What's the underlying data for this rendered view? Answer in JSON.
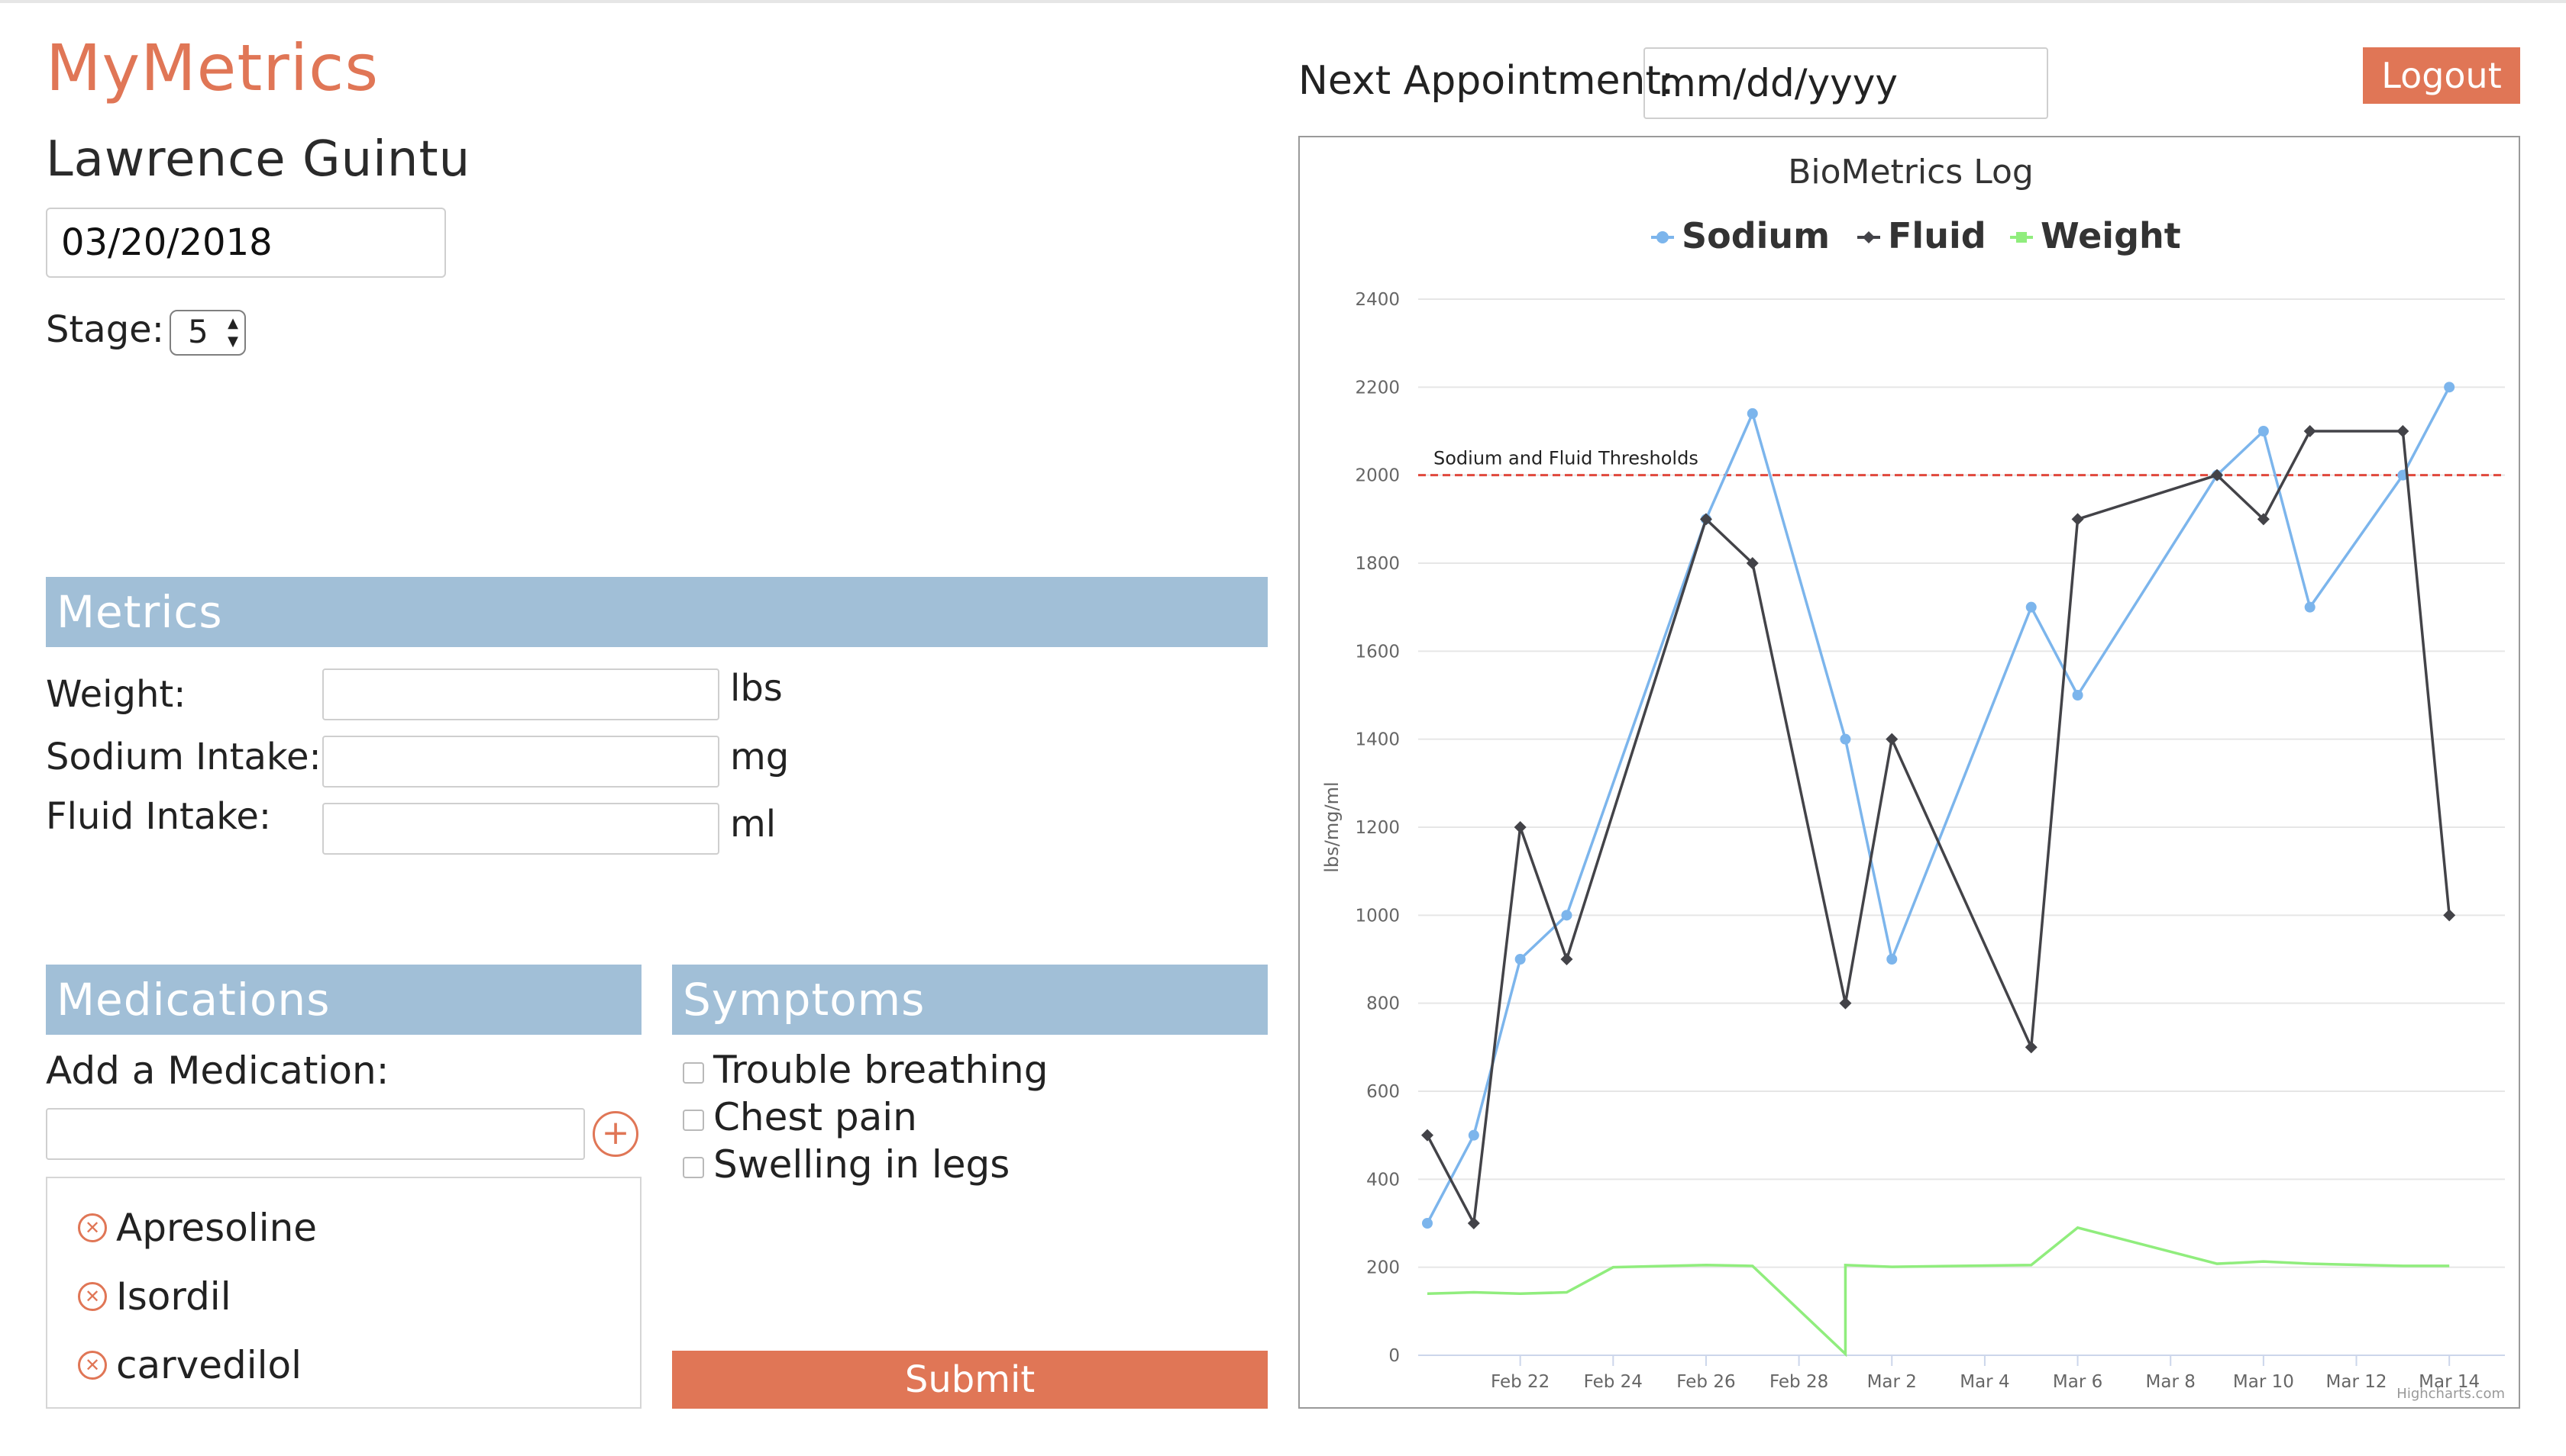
{
  "app": {
    "title": "MyMetrics"
  },
  "patient": {
    "name": "Lawrence Guintu",
    "date": "03/20/2018"
  },
  "stage": {
    "label": "Stage:",
    "value": "5"
  },
  "appointment": {
    "label": "Next Appointment:",
    "placeholder": "mm/dd/yyyy"
  },
  "header": {
    "logout_label": "Logout"
  },
  "metrics": {
    "title": "Metrics",
    "fields": [
      {
        "label": "Weight:",
        "unit": "lbs",
        "value": ""
      },
      {
        "label": "Sodium Intake:",
        "unit": "mg",
        "value": ""
      },
      {
        "label": "Fluid Intake:",
        "unit": "ml",
        "value": ""
      }
    ]
  },
  "medications": {
    "title": "Medications",
    "add_label": "Add a Medication:",
    "input_value": "",
    "add_icon": "plus-circle-icon",
    "remove_icon": "x-circle-icon",
    "items": [
      "Apresoline",
      "Isordil",
      "carvedilol"
    ]
  },
  "symptoms": {
    "title": "Symptoms",
    "items": [
      {
        "label": "Trouble breathing",
        "checked": false
      },
      {
        "label": "Chest pain",
        "checked": false
      },
      {
        "label": "Swelling in legs",
        "checked": false
      }
    ]
  },
  "submit_label": "Submit",
  "colors": {
    "accent": "#e07656",
    "section": "#a1bfd7",
    "sodium": "#7cb5ec",
    "fluid": "#434348",
    "weight": "#90ed7d",
    "threshold": "#e0483c"
  },
  "chart_data": {
    "type": "line",
    "title": "BioMetrics Log",
    "ylabel": "lbs/mg/ml",
    "ylim": [
      0,
      2400
    ],
    "yticks": [
      0,
      200,
      400,
      600,
      800,
      1000,
      1200,
      1400,
      1600,
      1800,
      2000,
      2200,
      2400
    ],
    "xlim": [
      "2018-02-20",
      "2018-03-15"
    ],
    "xticks": [
      "Feb 22",
      "Feb 24",
      "Feb 26",
      "Feb 28",
      "Mar 2",
      "Mar 4",
      "Mar 6",
      "Mar 8",
      "Mar 10",
      "Mar 12",
      "Mar 14"
    ],
    "xtick_dates": [
      "2018-02-22",
      "2018-02-24",
      "2018-02-26",
      "2018-02-28",
      "2018-03-02",
      "2018-03-04",
      "2018-03-06",
      "2018-03-08",
      "2018-03-10",
      "2018-03-12",
      "2018-03-14"
    ],
    "legend_position": "top-center",
    "grid": true,
    "plot_line": {
      "value": 2000,
      "label": "Sodium and Fluid Thresholds"
    },
    "credits": "Highcharts.com",
    "series": [
      {
        "name": "Sodium",
        "color": "#7cb5ec",
        "marker": "circle",
        "points": [
          {
            "x": "2018-02-20",
            "y": 300
          },
          {
            "x": "2018-02-21",
            "y": 500
          },
          {
            "x": "2018-02-22",
            "y": 900
          },
          {
            "x": "2018-02-23",
            "y": 1000
          },
          {
            "x": "2018-02-26",
            "y": 1900
          },
          {
            "x": "2018-02-27",
            "y": 2140
          },
          {
            "x": "2018-03-01",
            "y": 1400
          },
          {
            "x": "2018-03-02",
            "y": 900
          },
          {
            "x": "2018-03-05",
            "y": 1700
          },
          {
            "x": "2018-03-06",
            "y": 1500
          },
          {
            "x": "2018-03-09",
            "y": 2000
          },
          {
            "x": "2018-03-10",
            "y": 2100
          },
          {
            "x": "2018-03-11",
            "y": 1700
          },
          {
            "x": "2018-03-13",
            "y": 2000
          },
          {
            "x": "2018-03-14",
            "y": 2200
          }
        ]
      },
      {
        "name": "Fluid",
        "color": "#434348",
        "marker": "diamond",
        "points": [
          {
            "x": "2018-02-20",
            "y": 500
          },
          {
            "x": "2018-02-21",
            "y": 300
          },
          {
            "x": "2018-02-22",
            "y": 1200
          },
          {
            "x": "2018-02-23",
            "y": 900
          },
          {
            "x": "2018-02-26",
            "y": 1900
          },
          {
            "x": "2018-02-27",
            "y": 1800
          },
          {
            "x": "2018-03-01",
            "y": 800
          },
          {
            "x": "2018-03-02",
            "y": 1400
          },
          {
            "x": "2018-03-05",
            "y": 700
          },
          {
            "x": "2018-03-06",
            "y": 1900
          },
          {
            "x": "2018-03-09",
            "y": 2000
          },
          {
            "x": "2018-03-10",
            "y": 1900
          },
          {
            "x": "2018-03-11",
            "y": 2100
          },
          {
            "x": "2018-03-13",
            "y": 2100
          },
          {
            "x": "2018-03-14",
            "y": 1000
          }
        ]
      },
      {
        "name": "Weight",
        "color": "#90ed7d",
        "marker": "square",
        "points": [
          {
            "x": "2018-02-20",
            "y": 140
          },
          {
            "x": "2018-02-21",
            "y": 143
          },
          {
            "x": "2018-02-22",
            "y": 140
          },
          {
            "x": "2018-02-23",
            "y": 143
          },
          {
            "x": "2018-02-24",
            "y": 200
          },
          {
            "x": "2018-02-26",
            "y": 205
          },
          {
            "x": "2018-02-27",
            "y": 203
          },
          {
            "x": "2018-03-01",
            "y": 3
          },
          {
            "x": "2018-03-01",
            "y": 205
          },
          {
            "x": "2018-03-02",
            "y": 201
          },
          {
            "x": "2018-03-05",
            "y": 205
          },
          {
            "x": "2018-03-06",
            "y": 290
          },
          {
            "x": "2018-03-09",
            "y": 208
          },
          {
            "x": "2018-03-10",
            "y": 213
          },
          {
            "x": "2018-03-11",
            "y": 208
          },
          {
            "x": "2018-03-13",
            "y": 203
          },
          {
            "x": "2018-03-14",
            "y": 203
          }
        ]
      }
    ]
  }
}
